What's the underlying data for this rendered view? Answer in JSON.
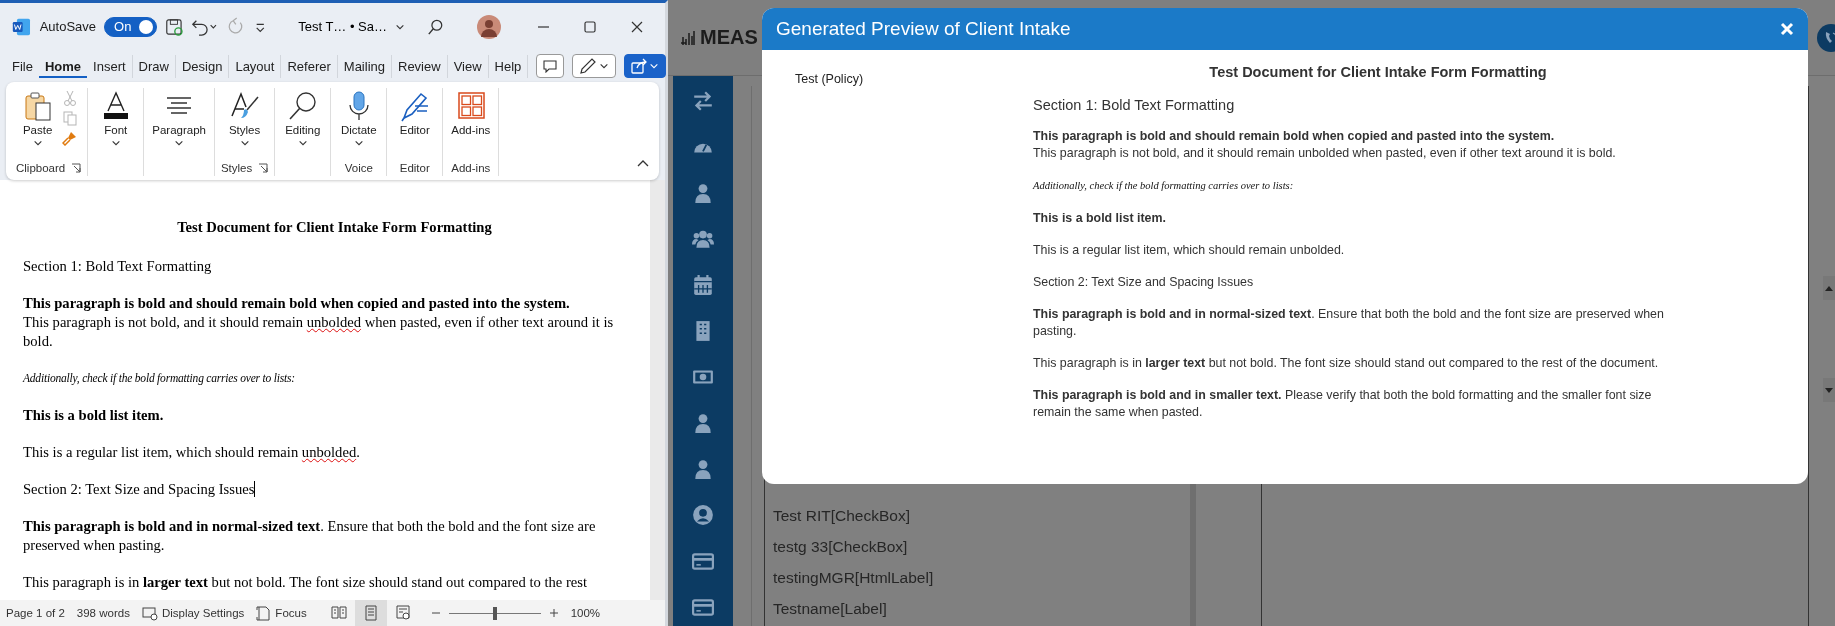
{
  "word": {
    "autosave": {
      "label": "AutoSave",
      "toggle_label": "On",
      "on": true
    },
    "document_title": "Test T… • Sa…",
    "tabs": [
      {
        "label": "File",
        "selected": false
      },
      {
        "label": "Home",
        "selected": true
      },
      {
        "label": "Insert",
        "selected": false
      },
      {
        "label": "Draw",
        "selected": false
      },
      {
        "label": "Design",
        "selected": false
      },
      {
        "label": "Layout",
        "selected": false
      },
      {
        "label": "Referer",
        "selected": false
      },
      {
        "label": "Mailing",
        "selected": false
      },
      {
        "label": "Review",
        "selected": false
      },
      {
        "label": "View",
        "selected": false
      },
      {
        "label": "Help",
        "selected": false
      }
    ],
    "ribbon": {
      "groups": [
        {
          "label": "Clipboard",
          "launcher": true,
          "buttons": [
            {
              "kind": "paste",
              "label": "Paste",
              "dropdown": true
            }
          ],
          "small_buttons": [
            {
              "kind": "cut",
              "disabled": true
            },
            {
              "kind": "copy",
              "disabled": true
            },
            {
              "kind": "painter",
              "disabled": false
            }
          ]
        },
        {
          "buttons": [
            {
              "kind": "font",
              "label": "Font",
              "dropdown": true
            }
          ]
        },
        {
          "buttons": [
            {
              "kind": "paragraph",
              "label": "Paragraph",
              "dropdown": true
            }
          ]
        },
        {
          "label": "Styles",
          "launcher": true,
          "buttons": [
            {
              "kind": "styles",
              "label": "Styles",
              "dropdown": true
            }
          ]
        },
        {
          "buttons": [
            {
              "kind": "editing",
              "label": "Editing",
              "dropdown": true
            }
          ]
        },
        {
          "label": "Voice",
          "buttons": [
            {
              "kind": "dictate",
              "label": "Dictate",
              "dropdown": true
            }
          ]
        },
        {
          "label": "Editor",
          "buttons": [
            {
              "kind": "editor",
              "label": "Editor",
              "dropdown": false
            }
          ]
        },
        {
          "label": "Add-ins",
          "buttons": [
            {
              "kind": "addins",
              "label": "Add-ins",
              "dropdown": false
            }
          ]
        }
      ]
    },
    "document": {
      "paragraphs": [
        {
          "kind": "title",
          "runs": [
            {
              "text": "Test Document for Client Intake Form Formatting"
            }
          ]
        },
        {
          "kind": "normal",
          "runs": [
            {
              "text": "Section 1: Bold Text Formatting"
            }
          ]
        },
        {
          "kind": "normal",
          "runs": [
            {
              "text": "This paragraph is bold and should remain bold when copied and pasted into the system.",
              "bold": true
            },
            {
              "text": "This paragraph is not bold, and it should remain ",
              "new_line": true
            },
            {
              "text": "unbolded",
              "misspelled": true
            },
            {
              "text": " when pasted, even if other text around it is bold."
            }
          ]
        },
        {
          "kind": "script",
          "runs": [
            {
              "text": "Additionally, check if the bold formatting carries over to lists:"
            }
          ]
        },
        {
          "kind": "normal",
          "runs": [
            {
              "text": "This is a bold list item.",
              "bold": true
            }
          ]
        },
        {
          "kind": "normal",
          "runs": [
            {
              "text": "This is a regular list item, which should remain "
            },
            {
              "text": "unbolded",
              "misspelled": true
            },
            {
              "text": "."
            }
          ]
        },
        {
          "kind": "normal",
          "cursor": true,
          "runs": [
            {
              "text": "Section 2: Text Size and Spacing Issues"
            }
          ]
        },
        {
          "kind": "normal",
          "runs": [
            {
              "text": "This paragraph is bold and in normal-sized text",
              "bold": true
            },
            {
              "text": ". Ensure that both the bold and the font size are preserved when pasting."
            }
          ]
        },
        {
          "kind": "normal",
          "runs": [
            {
              "text": "This paragraph is in "
            },
            {
              "text": "larger text",
              "bold": true
            },
            {
              "text": " but not bold. The font size should stand out compared to the rest"
            }
          ]
        }
      ]
    },
    "status_bar": {
      "page": "Page 1 of 2",
      "words": "398 words",
      "display_settings": "Display Settings",
      "focus": "Focus",
      "views": [
        {
          "kind": "read",
          "selected": false
        },
        {
          "kind": "print",
          "selected": true
        },
        {
          "kind": "web",
          "selected": false
        }
      ],
      "zoom": {
        "level": 0.5,
        "label": "100%"
      }
    }
  },
  "app": {
    "logo": "MEAS",
    "sidebar": {
      "items": [
        {
          "kind": "swap"
        },
        {
          "kind": "gauge"
        },
        {
          "kind": "user"
        },
        {
          "kind": "users"
        },
        {
          "kind": "calendar"
        },
        {
          "kind": "building"
        },
        {
          "kind": "money"
        },
        {
          "kind": "user"
        },
        {
          "kind": "user"
        },
        {
          "kind": "user-circle"
        },
        {
          "kind": "card"
        },
        {
          "kind": "card"
        }
      ]
    },
    "list": {
      "items": [
        "Test RIT[CheckBox]",
        "testg 33[CheckBox]",
        "testingMGR[HtmlLabel]",
        "Testname[Label]"
      ]
    }
  },
  "modal": {
    "title": "Generated Preview of Client Intake",
    "label": "Test (Policy)",
    "paragraphs": [
      {
        "kind": "title",
        "runs": [
          {
            "text": "Test Document for Client Intake Form Formatting"
          }
        ]
      },
      {
        "kind": "large",
        "runs": [
          {
            "text": "Section 1: Bold Text Formatting"
          }
        ]
      },
      {
        "kind": "normal",
        "runs": [
          {
            "text": "This paragraph is bold and should remain bold when copied and pasted into the system.",
            "bold": true
          },
          {
            "text": "This paragraph is not bold, and it should remain unbolded when pasted, even if other text around it is bold.",
            "new_line": true
          }
        ]
      },
      {
        "kind": "script",
        "runs": [
          {
            "text": "Additionally, check if the bold formatting carries over to lists:"
          }
        ]
      },
      {
        "kind": "normal",
        "runs": [
          {
            "text": "This is a bold list item.",
            "bold": true
          }
        ]
      },
      {
        "kind": "normal",
        "runs": [
          {
            "text": "This is a regular list item, which should remain unbolded."
          }
        ]
      },
      {
        "kind": "normal",
        "runs": [
          {
            "text": "Section 2: Text Size and Spacing Issues"
          }
        ]
      },
      {
        "kind": "normal",
        "runs": [
          {
            "text": "This paragraph is bold and in normal-sized text",
            "bold": true
          },
          {
            "text": ". Ensure that both the bold and the font size are preserved when pasting."
          }
        ]
      },
      {
        "kind": "normal",
        "runs": [
          {
            "text": "This paragraph is in "
          },
          {
            "text": "larger text",
            "bold": true
          },
          {
            "text": " but not bold. The font size should stand out compared to the rest of the document."
          }
        ]
      },
      {
        "kind": "normal",
        "runs": [
          {
            "text": "This paragraph is bold and in smaller text.",
            "bold": true
          },
          {
            "text": " Please verify that both the bold formatting and the smaller font size remain the same when pasted."
          }
        ]
      }
    ]
  }
}
